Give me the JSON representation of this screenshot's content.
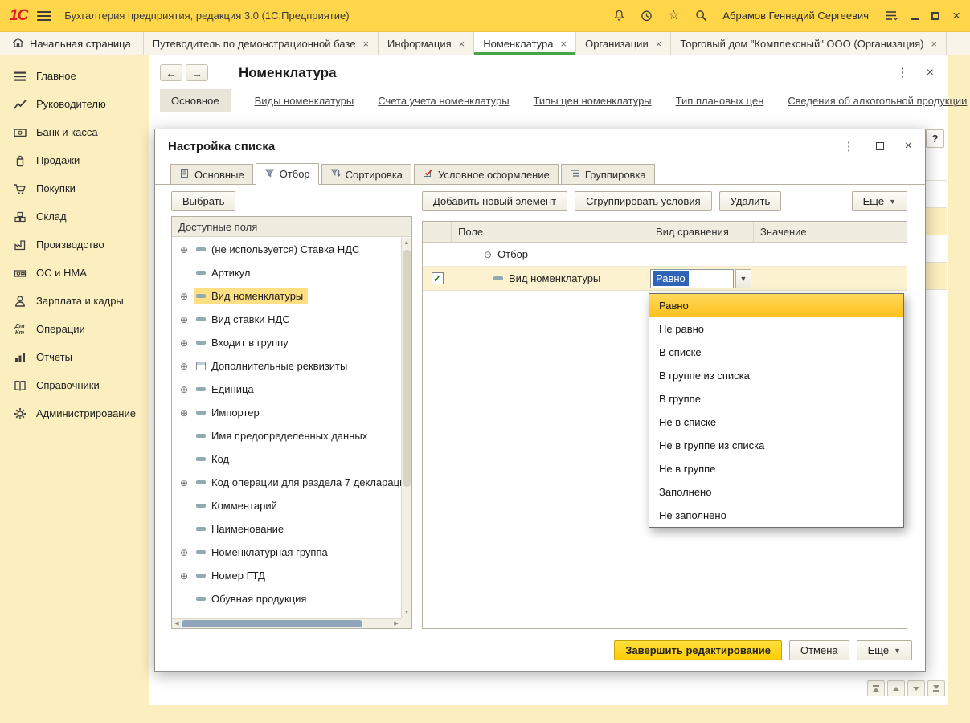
{
  "titlebar": {
    "app_title": "Бухгалтерия предприятия, редакция 3.0  (1С:Предприятие)",
    "user_name": "Абрамов Геннадий Сергеевич",
    "logo": "1С"
  },
  "tabbar": {
    "home_label": "Начальная страница",
    "tabs": [
      {
        "label": "Путеводитель по демонстрационной базе"
      },
      {
        "label": "Информация"
      },
      {
        "label": "Номенклатура",
        "active": true
      },
      {
        "label": "Организации"
      },
      {
        "label": "Торговый дом \"Комплексный\" ООО (Организация)"
      }
    ]
  },
  "sidebar": {
    "items": [
      {
        "label": "Главное"
      },
      {
        "label": "Руководителю"
      },
      {
        "label": "Банк и касса"
      },
      {
        "label": "Продажи"
      },
      {
        "label": "Покупки"
      },
      {
        "label": "Склад"
      },
      {
        "label": "Производство"
      },
      {
        "label": "ОС и НМА"
      },
      {
        "label": "Зарплата и кадры"
      },
      {
        "label": "Операции"
      },
      {
        "label": "Отчеты"
      },
      {
        "label": "Справочники"
      },
      {
        "label": "Администрирование"
      }
    ],
    "operations_icon_text": {
      "top": "Дт",
      "bottom": "Кт"
    }
  },
  "page": {
    "title": "Номенклатура",
    "active_section": "Основное",
    "links": [
      {
        "label": "Виды номенклатуры"
      },
      {
        "label": "Счета учета номенклатуры"
      },
      {
        "label": "Типы цен номенклатуры"
      },
      {
        "label": "Тип плановых цен"
      },
      {
        "label": "Сведения об алкогольной продукции"
      }
    ],
    "help_label": "?"
  },
  "dialog": {
    "title": "Настройка списка",
    "tabs": [
      {
        "label": "Основные"
      },
      {
        "label": "Отбор",
        "active": true
      },
      {
        "label": "Сортировка"
      },
      {
        "label": "Условное оформление"
      },
      {
        "label": "Группировка"
      }
    ],
    "left": {
      "select_button": "Выбрать",
      "header": "Доступные поля",
      "fields": [
        {
          "label": "(не используется) Ставка НДС",
          "expandable": true
        },
        {
          "label": "Артикул"
        },
        {
          "label": "Вид номенклатуры",
          "expandable": true,
          "selected": true
        },
        {
          "label": "Вид ставки НДС",
          "expandable": true
        },
        {
          "label": "Входит в группу",
          "expandable": true
        },
        {
          "label": "Дополнительные реквизиты",
          "expandable": true,
          "table": true
        },
        {
          "label": "Единица",
          "expandable": true
        },
        {
          "label": "Импортер",
          "expandable": true
        },
        {
          "label": "Имя предопределенных данных"
        },
        {
          "label": "Код"
        },
        {
          "label": "Код операции для раздела 7 деклараци",
          "expandable": true
        },
        {
          "label": "Комментарий"
        },
        {
          "label": "Наименование"
        },
        {
          "label": "Номенклатурная группа",
          "expandable": true
        },
        {
          "label": "Номер ГТД",
          "expandable": true
        },
        {
          "label": "Обувная продукция"
        }
      ]
    },
    "right": {
      "add_button": "Добавить новый элемент",
      "group_button": "Сгруппировать условия",
      "delete_button": "Удалить",
      "more_button": "Еще",
      "columns": [
        "Поле",
        "Вид сравнения",
        "Значение"
      ],
      "group_row_label": "Отбор",
      "row": {
        "field": "Вид номенклатуры",
        "comparison": "Равно",
        "value": ""
      },
      "dropdown_options": [
        {
          "label": "Равно",
          "selected": true
        },
        {
          "label": "Не равно"
        },
        {
          "label": "В списке"
        },
        {
          "label": "В группе из списка"
        },
        {
          "label": "В группе"
        },
        {
          "label": "Не в списке"
        },
        {
          "label": "Не в группе из списка"
        },
        {
          "label": "Не в группе"
        },
        {
          "label": "Заполнено"
        },
        {
          "label": "Не заполнено"
        }
      ]
    },
    "footer": {
      "finish_button": "Завершить редактирование",
      "cancel_button": "Отмена",
      "more_button": "Еще"
    }
  }
}
